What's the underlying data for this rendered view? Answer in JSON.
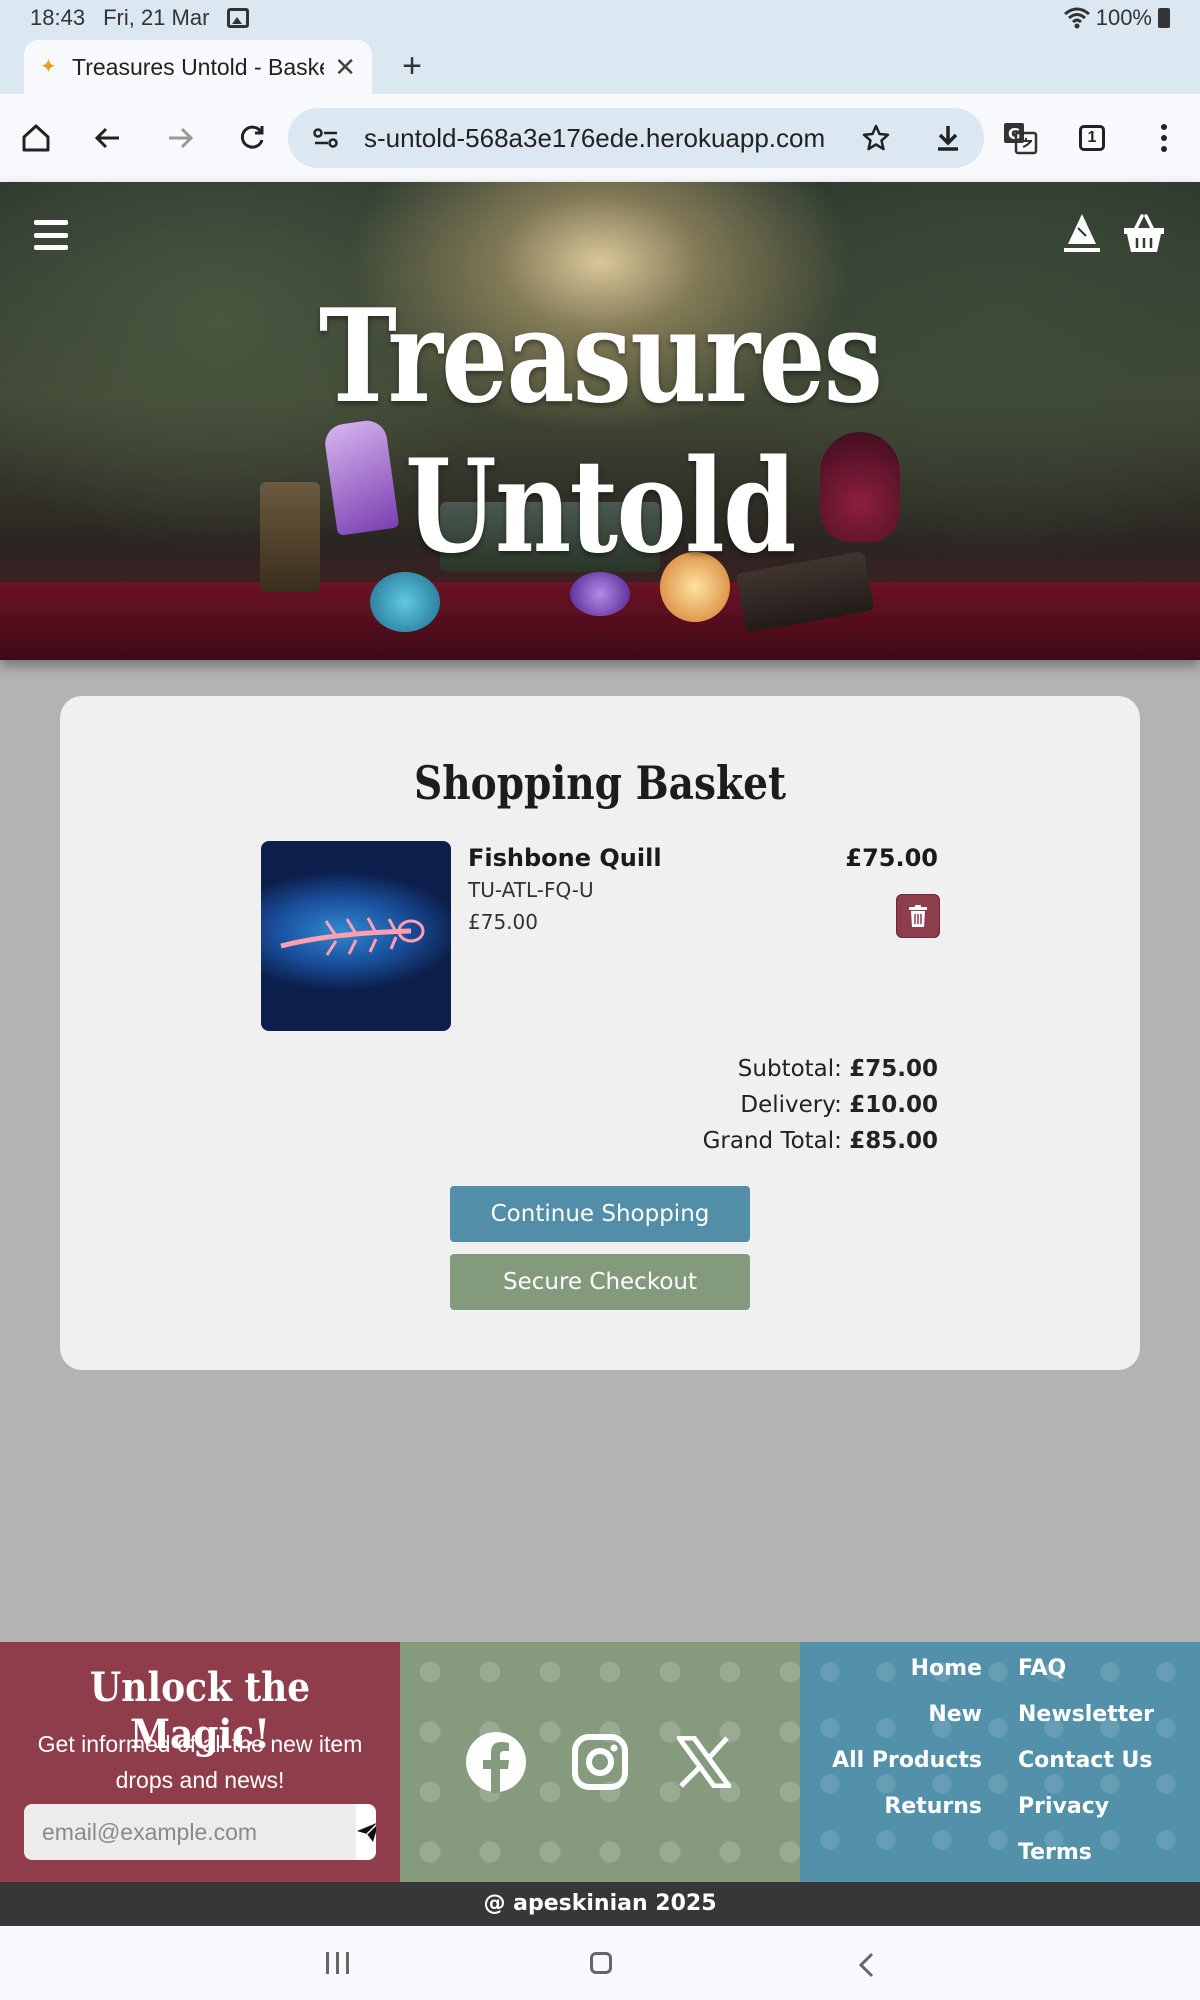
{
  "status_bar": {
    "time": "18:43",
    "date": "Fri, 21 Mar",
    "battery": "100%"
  },
  "browser": {
    "tab_title": "Treasures Untold - Baske",
    "url": "s-untold-568a3e176ede.herokuapp.com",
    "tab_count": "1"
  },
  "site": {
    "title": "Treasures Untold"
  },
  "basket": {
    "heading": "Shopping Basket",
    "items": [
      {
        "name": "Fishbone Quill",
        "sku": "TU-ATL-FQ-U",
        "price": "£75.00",
        "line_total": "£75.00"
      }
    ],
    "subtotal_label": "Subtotal:",
    "subtotal": "£75.00",
    "delivery_label": "Delivery:",
    "delivery": "£10.00",
    "grand_total_label": "Grand Total:",
    "grand_total": "£85.00",
    "continue_label": "Continue Shopping",
    "checkout_label": "Secure Checkout"
  },
  "footer": {
    "newsletter_title": "Unlock the Magic!",
    "newsletter_text": "Get informed of all the new item drops and news!",
    "email_placeholder": "email@example.com",
    "links_left": [
      "Home",
      "New",
      "All Products",
      "Returns"
    ],
    "links_right": [
      "FAQ",
      "Newsletter",
      "Contact Us",
      "Privacy",
      "Terms"
    ],
    "copyright": "@ apeskinian 2025"
  },
  "colors": {
    "continue": "#528ea8",
    "checkout": "#839a7c",
    "delete": "#8e3d4c",
    "footer_left": "#8f3d4a",
    "footer_mid": "#869b7e",
    "footer_right": "#5391ab"
  },
  "icons": [
    "home-icon",
    "back-arrow-icon",
    "forward-arrow-icon",
    "reload-icon",
    "site-settings-icon",
    "star-icon",
    "download-icon",
    "translate-icon",
    "menu-icon",
    "wizard-hat-icon",
    "basket-icon",
    "trash-icon",
    "send-icon",
    "facebook-icon",
    "instagram-icon",
    "x-icon"
  ]
}
